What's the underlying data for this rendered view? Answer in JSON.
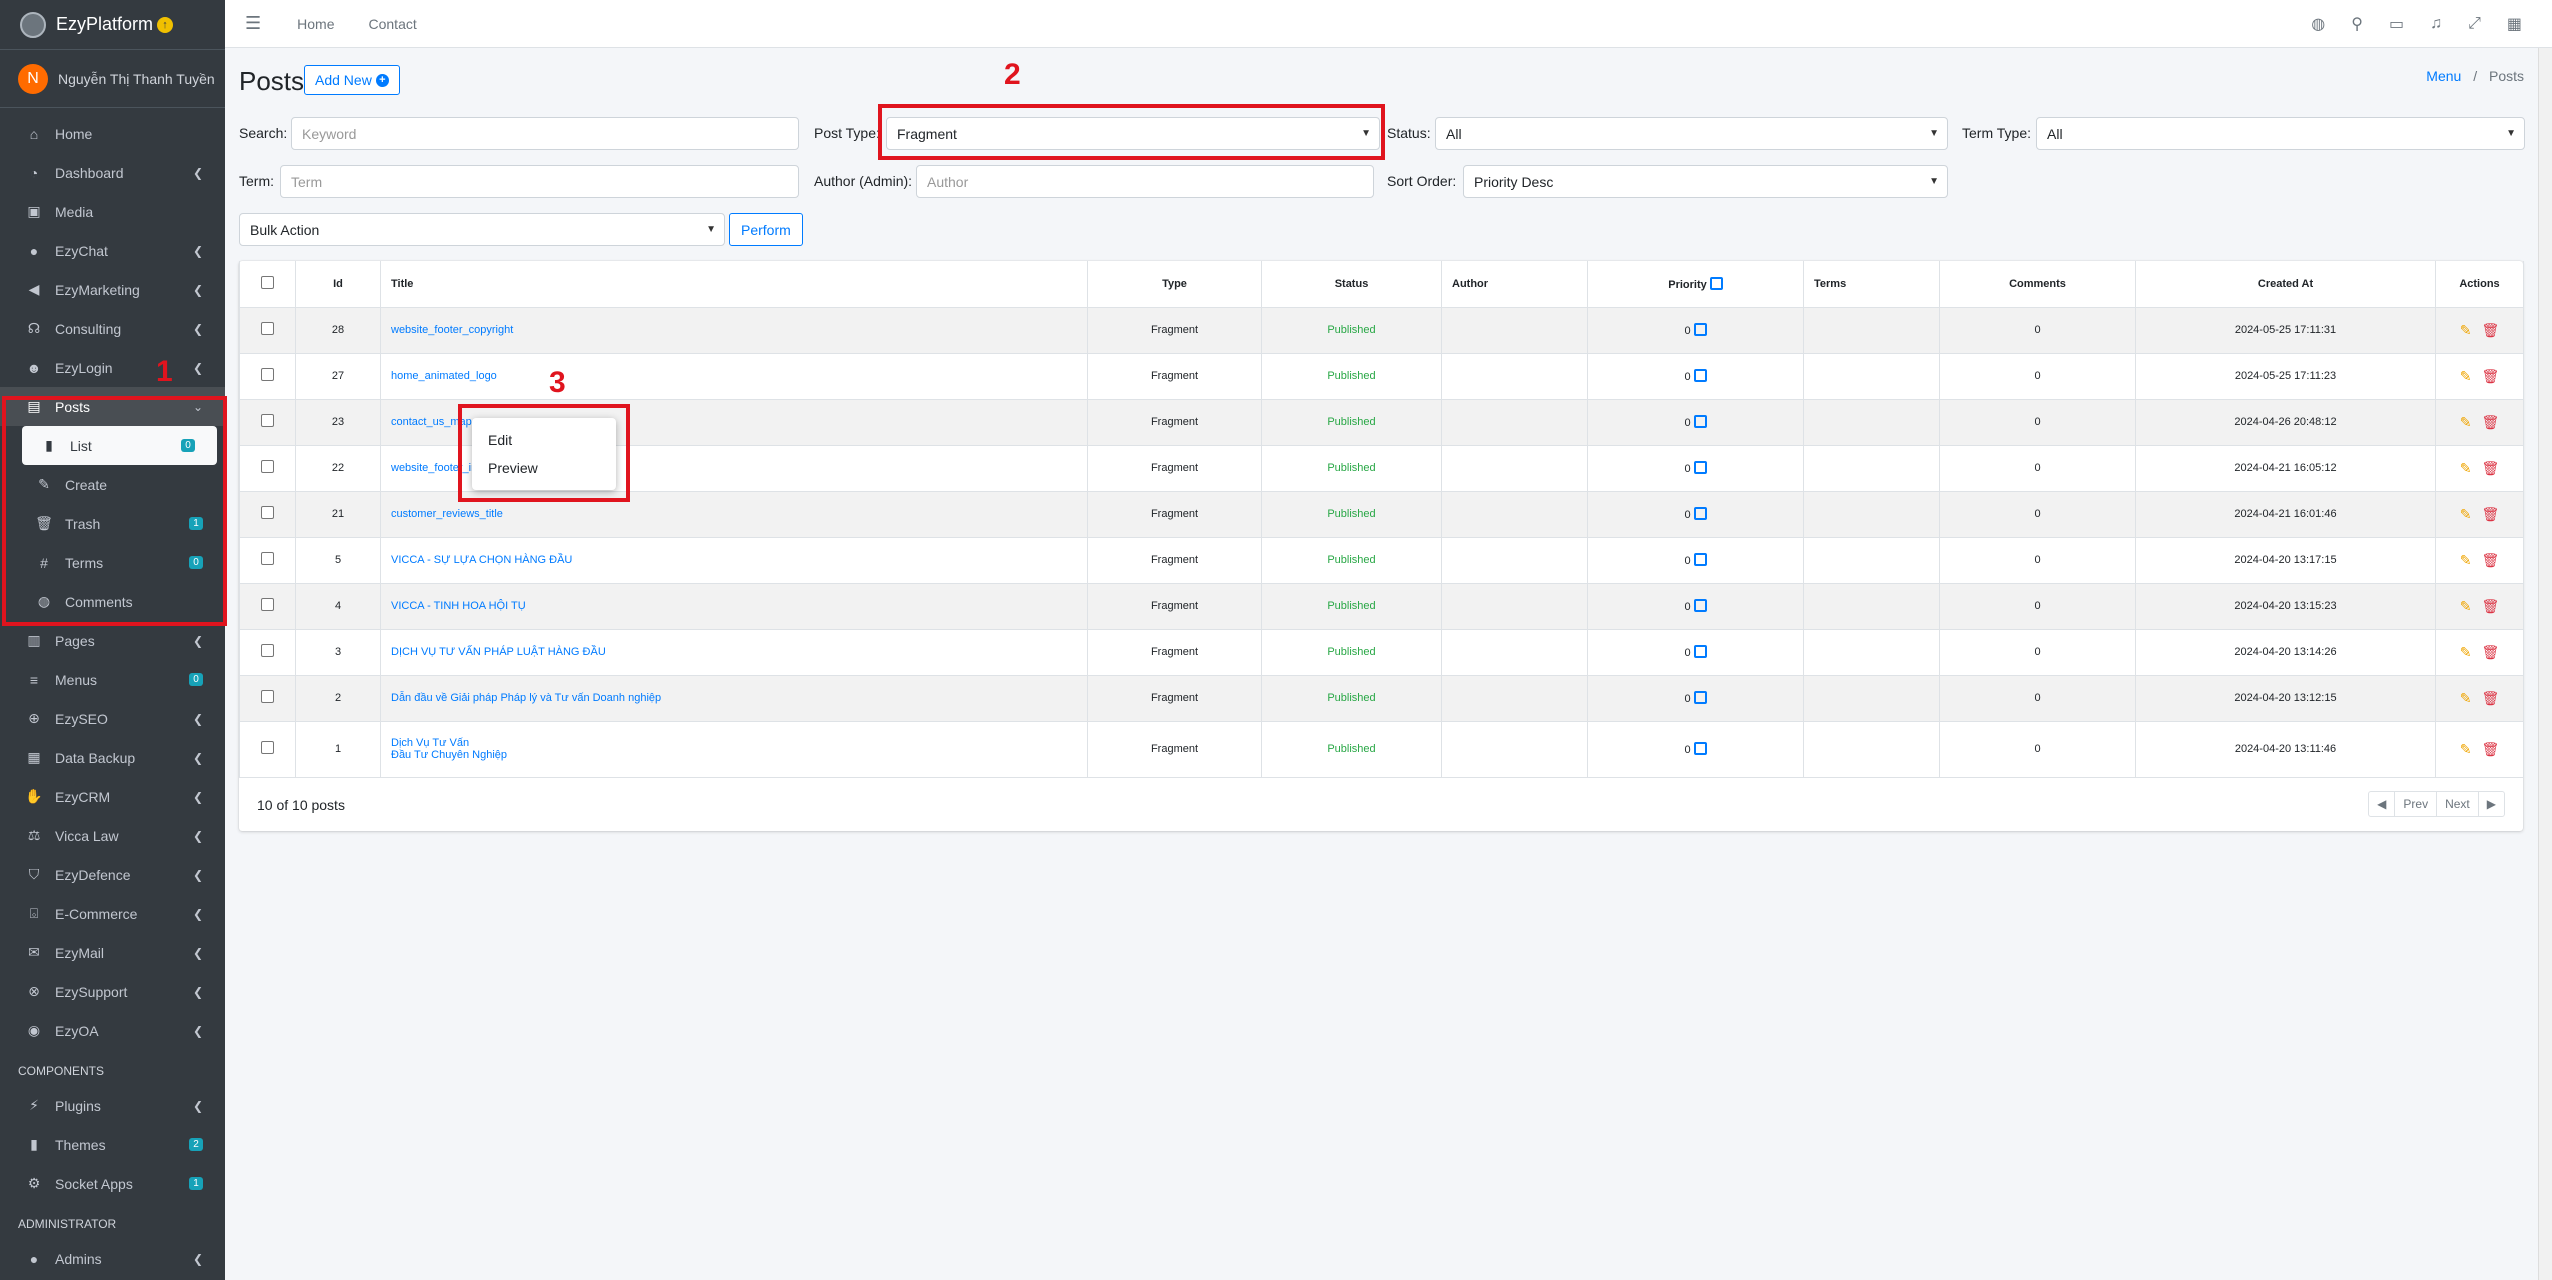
{
  "brand": {
    "name": "EzyPlatform"
  },
  "user": {
    "initial": "N",
    "name": "Nguyễn Thị Thanh Tuyền"
  },
  "sidebar": {
    "items": [
      {
        "label": "Home",
        "icon": "home-icon"
      },
      {
        "label": "Dashboard",
        "icon": "dashboard-icon"
      },
      {
        "label": "Media",
        "icon": "media-icon"
      },
      {
        "label": "EzyChat",
        "icon": "chat-icon"
      },
      {
        "label": "EzyMarketing",
        "icon": "megaphone-icon"
      },
      {
        "label": "Consulting",
        "icon": "headset-icon"
      },
      {
        "label": "EzyLogin",
        "icon": "user-lock-icon"
      },
      {
        "label": "Posts",
        "icon": "posts-icon"
      }
    ],
    "posts_sub": [
      {
        "label": "List",
        "badge": "0"
      },
      {
        "label": "Create",
        "badge": ""
      },
      {
        "label": "Trash",
        "badge": "1"
      },
      {
        "label": "Terms",
        "badge": "0"
      },
      {
        "label": "Comments",
        "badge": ""
      }
    ],
    "items2": [
      {
        "label": "Pages",
        "badge": ""
      },
      {
        "label": "Menus",
        "badge": "0"
      },
      {
        "label": "EzySEO",
        "badge": ""
      },
      {
        "label": "Data Backup",
        "badge": ""
      },
      {
        "label": "EzyCRM",
        "badge": ""
      },
      {
        "label": "Vicca Law",
        "badge": ""
      },
      {
        "label": "EzyDefence",
        "badge": ""
      },
      {
        "label": "E-Commerce",
        "badge": ""
      },
      {
        "label": "EzyMail",
        "badge": ""
      },
      {
        "label": "EzySupport",
        "badge": ""
      },
      {
        "label": "EzyOA",
        "badge": ""
      }
    ],
    "components_header": "COMPONENTS",
    "components": [
      {
        "label": "Plugins",
        "badge": ""
      },
      {
        "label": "Themes",
        "badge": "2"
      },
      {
        "label": "Socket Apps",
        "badge": "1"
      }
    ],
    "admin_header": "ADMINISTRATOR",
    "admin": [
      {
        "label": "Admins"
      }
    ]
  },
  "topbar": {
    "home": "Home",
    "contact": "Contact"
  },
  "page": {
    "title": "Posts",
    "add_new": "Add New"
  },
  "breadcrumb": {
    "menu": "Menu",
    "sep": "/",
    "current": "Posts"
  },
  "filters": {
    "search_label": "Search:",
    "search_placeholder": "Keyword",
    "post_type_label": "Post Type:",
    "post_type_value": "Fragment",
    "status_label": "Status:",
    "status_value": "All",
    "term_type_label": "Term Type:",
    "term_type_value": "All",
    "term_label": "Term:",
    "term_placeholder": "Term",
    "author_label": "Author (Admin):",
    "author_placeholder": "Author",
    "sort_label": "Sort Order:",
    "sort_value": "Priority Desc",
    "bulk_value": "Bulk Action",
    "perform": "Perform"
  },
  "table": {
    "headers": {
      "id": "Id",
      "title": "Title",
      "type": "Type",
      "status": "Status",
      "author": "Author",
      "priority": "Priority",
      "terms": "Terms",
      "comments": "Comments",
      "created": "Created At",
      "actions": "Actions"
    },
    "rows": [
      {
        "id": "28",
        "title": "website_footer_copyright",
        "type": "Fragment",
        "status": "Published",
        "priority": "0",
        "comments": "0",
        "created": "2024-05-25 17:11:31"
      },
      {
        "id": "27",
        "title": "home_animated_logo",
        "type": "Fragment",
        "status": "Published",
        "priority": "0",
        "comments": "0",
        "created": "2024-05-25 17:11:23"
      },
      {
        "id": "23",
        "title": "contact_us_map",
        "type": "Fragment",
        "status": "Published",
        "priority": "0",
        "comments": "0",
        "created": "2024-04-26 20:48:12"
      },
      {
        "id": "22",
        "title": "website_footer_info",
        "type": "Fragment",
        "status": "Published",
        "priority": "0",
        "comments": "0",
        "created": "2024-04-21 16:05:12"
      },
      {
        "id": "21",
        "title": "customer_reviews_title",
        "type": "Fragment",
        "status": "Published",
        "priority": "0",
        "comments": "0",
        "created": "2024-04-21 16:01:46"
      },
      {
        "id": "5",
        "title": "VICCA - SỰ LỰA CHỌN HÀNG ĐẦU",
        "type": "Fragment",
        "status": "Published",
        "priority": "0",
        "comments": "0",
        "created": "2024-04-20 13:17:15"
      },
      {
        "id": "4",
        "title": "VICCA - TINH HOA HỘI TỤ",
        "type": "Fragment",
        "status": "Published",
        "priority": "0",
        "comments": "0",
        "created": "2024-04-20 13:15:23"
      },
      {
        "id": "3",
        "title": "DỊCH VỤ TƯ VẤN PHÁP LUẬT HÀNG ĐẦU",
        "type": "Fragment",
        "status": "Published",
        "priority": "0",
        "comments": "0",
        "created": "2024-04-20 13:14:26"
      },
      {
        "id": "2",
        "title": "Dẫn đầu về Giải pháp Pháp lý và Tư vấn Doanh nghiệp",
        "type": "Fragment",
        "status": "Published",
        "priority": "0",
        "comments": "0",
        "created": "2024-04-20 13:12:15"
      },
      {
        "id": "1",
        "title": "Dịch Vụ Tư Vấn",
        "title2": "Đầu Tư Chuyên Nghiệp",
        "type": "Fragment",
        "status": "Published",
        "priority": "0",
        "comments": "0",
        "created": "2024-04-20 13:11:46"
      }
    ],
    "footer": "10 of 10 posts",
    "pager": {
      "prev": "Prev",
      "next": "Next"
    }
  },
  "context_menu": {
    "edit": "Edit",
    "preview": "Preview"
  },
  "annotations": {
    "one": "1",
    "two": "2",
    "three": "3"
  },
  "colors": {
    "sidebar": "#343a40",
    "accent": "#007bff",
    "published": "#28a745",
    "annotation": "#e0141e"
  }
}
